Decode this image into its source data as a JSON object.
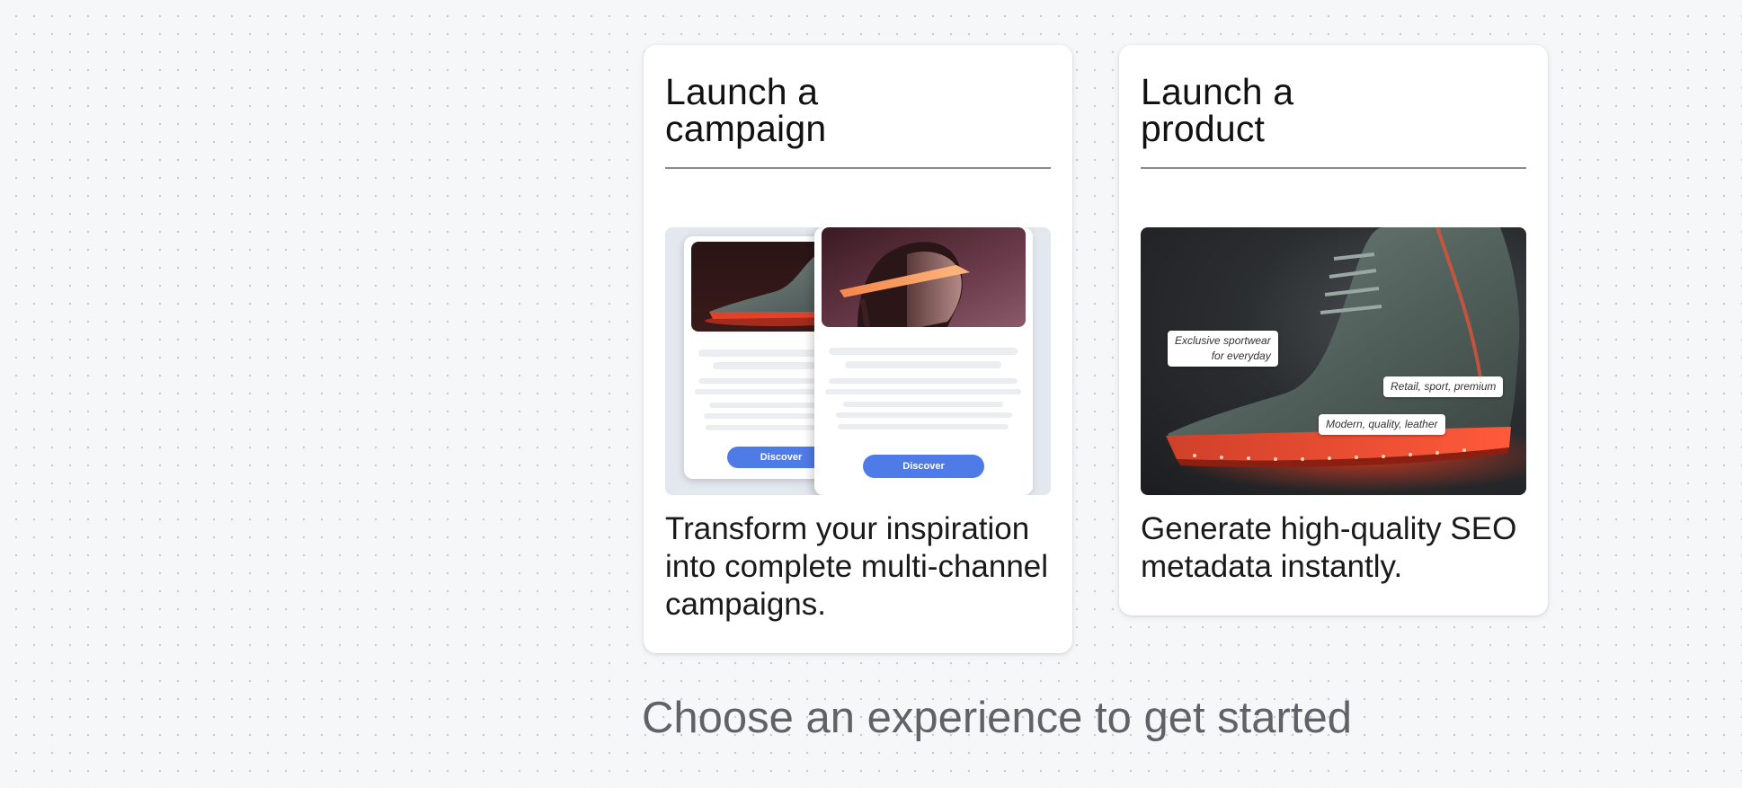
{
  "cards": [
    {
      "id": "campaign",
      "title_line1": "Launch a",
      "title_line2": "campaign",
      "description": "Transform your inspiration into complete multi-channel campaigns.",
      "illustration": {
        "back_button_label": "Discover",
        "front_button_label": "Discover"
      }
    },
    {
      "id": "product",
      "title_line1": "Launch a",
      "title_line2": "product",
      "description": "Generate high-quality SEO metadata instantly.",
      "illustration": {
        "tags": [
          {
            "line1": "Exclusive sportwear",
            "line2": "for everyday"
          },
          {
            "text": "Retail, sport, premium"
          },
          {
            "text": "Modern, quality, leather"
          }
        ]
      }
    }
  ],
  "footer": {
    "prompt": "Choose an experience to get started"
  },
  "colors": {
    "background": "#f6f7f9",
    "card": "#ffffff",
    "button_accent": "#4f7be6",
    "prompt_text": "#5f6368"
  }
}
